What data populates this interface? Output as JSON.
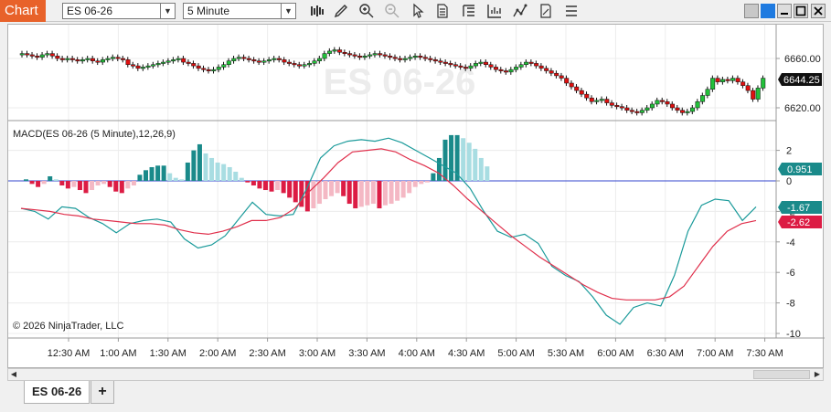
{
  "toolbar": {
    "chart_tab_label": "Chart",
    "instrument_value": "ES 06-26",
    "interval_value": "5 Minute",
    "icons": [
      "bar-type-icon",
      "draw-tool-icon",
      "zoom-in-icon",
      "zoom-out-icon",
      "pointer-icon",
      "data-box-icon",
      "templates-icon",
      "strategies-icon",
      "indicators-icon",
      "properties-icon",
      "more-icon"
    ],
    "window_icons": [
      "workspace-icon",
      "link-color-icon",
      "minimize-icon",
      "maximize-icon",
      "close-icon"
    ],
    "accent_color": "#e8622a",
    "link_color": "#1e7ae0"
  },
  "chart": {
    "watermark": "ES 06-26",
    "price_label": "6644.25",
    "macd_title": "MACD(ES 06-26 (5 Minute),12,26,9)",
    "copyright": "© 2026 NinjaTrader, LLC",
    "price_axis_ticks": [
      "6660.00",
      "6620.00"
    ],
    "macd_axis_ticks": [
      "2",
      "0",
      "-2",
      "-4",
      "-6",
      "-8",
      "-10"
    ],
    "time_axis_ticks": [
      "12:30 AM",
      "1:00 AM",
      "1:30 AM",
      "2:00 AM",
      "2:30 AM",
      "3:00 AM",
      "3:30 AM",
      "4:00 AM",
      "4:30 AM",
      "5:00 AM",
      "5:30 AM",
      "6:00 AM",
      "6:30 AM",
      "7:00 AM",
      "7:30 AM"
    ],
    "macd_value_labels": {
      "diff": "0.951",
      "macd": "-1.67",
      "avg": "-2.62"
    },
    "colors": {
      "up": "#22c03a",
      "down": "#e01010",
      "hist_up_strong": "#1a8a8a",
      "hist_up_weak": "#a8dde2",
      "hist_down_strong": "#dc1c44",
      "hist_down_weak": "#f4b8c4",
      "macd_line": "#1a9a9a",
      "avg_line": "#e0304c"
    }
  },
  "tabs": {
    "instrument_tab": "ES 06-26",
    "add_tab": "+"
  }
}
